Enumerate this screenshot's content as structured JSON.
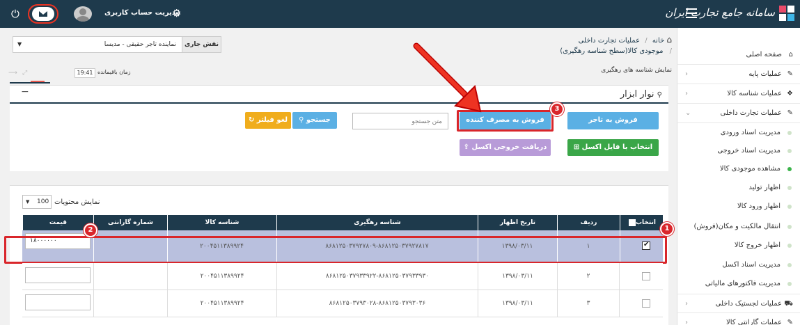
{
  "topbar": {
    "brand": "سامانه جامع تجارت ایران",
    "account_label": "مدیریت حساب کاربری",
    "logo_icon": "grid-logo-icon",
    "menu_icon": "hamburger-icon",
    "settings_icon": "gear-icon",
    "power_icon": "power-icon",
    "mail_icon": "envelope-icon"
  },
  "sidebar": {
    "items": [
      {
        "label": "صفحه اصلی",
        "icon": "home-icon"
      },
      {
        "label": "عملیات پایه",
        "icon": "edit-icon"
      },
      {
        "label": "عملیات شناسه کالا",
        "icon": "cubes-icon"
      },
      {
        "label": "عملیات تجارت داخلی",
        "icon": "edit-icon"
      }
    ],
    "sub_items": [
      {
        "label": "مدیریت اسناد ورودی"
      },
      {
        "label": "مدیریت اسناد خروجی"
      },
      {
        "label": "مشاهده موجودی کالا"
      },
      {
        "label": "اظهار تولید"
      },
      {
        "label": "اظهار ورود کالا"
      },
      {
        "label": "انتقال مالکیت و مکان(فروش)"
      },
      {
        "label": "اظهار خروج کالا"
      },
      {
        "label": "مدیریت اسناد اکسل"
      },
      {
        "label": "مدیریت فاکتورهای مالیاتی"
      }
    ],
    "bottom_items": [
      {
        "label": "عملیات لجستیک داخلی",
        "icon": "truck-icon"
      },
      {
        "label": "عملیات گارانتی کالا",
        "icon": "edit-icon"
      }
    ]
  },
  "breadcrumb": {
    "home": "خانه",
    "sep": "/",
    "level1": "عملیات تجارت داخلی",
    "level2": "موجودی کالا(سطح شناسه رهگیری)"
  },
  "role": {
    "label": "نقش جاری",
    "value": "نماینده تاجر حقیقی - مدیسا"
  },
  "subtitle": "نمایش شناسه های رهگیری",
  "timer": {
    "label": "زمان باقیمانده",
    "value": "19:41"
  },
  "toolbar": {
    "title": "نوار ابزار",
    "btn_sell_trader": "فروش به تاجر",
    "btn_sell_consumer": "فروش به مصرف کننده",
    "search_placeholder": "متن جستجو",
    "btn_search": "جستجو",
    "btn_clear_filter": "لغو فیلتر",
    "btn_select_excel": "انتخاب با فایل اکسل",
    "btn_export_excel": "دریافت خروجی اکسل",
    "collapse": "−"
  },
  "page_size": {
    "label": "نمایش محتویات",
    "value": "100"
  },
  "table": {
    "headers": [
      "انتخاب",
      "ردیف",
      "تاریخ اظهار",
      "شناسه رهگیری",
      "شناسه کالا",
      "شماره گارانتی",
      "قیمت"
    ],
    "rows": [
      {
        "checked": true,
        "row": "۱",
        "date": "۱۳۹۸/۰۳/۱۱",
        "tracking": "۸۶۸۱۲۵۰۳۷۹۲۷۸۰۹-۸۶۸۱۲۵۰۳۷۹۲۷۸۱۷",
        "product": "۲۰۰۴۵۱۱۳۸۹۹۲۴",
        "warranty": "",
        "price": "۱۸۰۰۰۰۰۰"
      },
      {
        "checked": false,
        "row": "۲",
        "date": "۱۳۹۸/۰۳/۱۱",
        "tracking": "۸۶۸۱۲۵۰۳۷۹۳۳۹۲۲-۸۶۸۱۲۵۰۳۷۹۳۳۹۳۰",
        "product": "۲۰۰۴۵۱۱۳۸۹۹۲۴",
        "warranty": "",
        "price": ""
      },
      {
        "checked": false,
        "row": "۳",
        "date": "۱۳۹۸/۰۳/۱۱",
        "tracking": "۸۶۸۱۲۵۰۳۷۹۳۰۲۸-۸۶۸۱۲۵۰۳۷۹۳۰۳۶",
        "product": "۲۰۰۴۵۱۱۳۸۹۹۲۴",
        "warranty": "",
        "price": ""
      }
    ]
  },
  "badges": [
    "1",
    "2",
    "3"
  ],
  "colors": {
    "topbar": "#1e3a4c",
    "btn_blue": "#5bb0e4",
    "btn_green": "#3aa648",
    "btn_purple": "#b89bd8",
    "btn_orange": "#f0ad1c",
    "highlight": "#d9262b",
    "selected_row": "#b9c0de"
  }
}
